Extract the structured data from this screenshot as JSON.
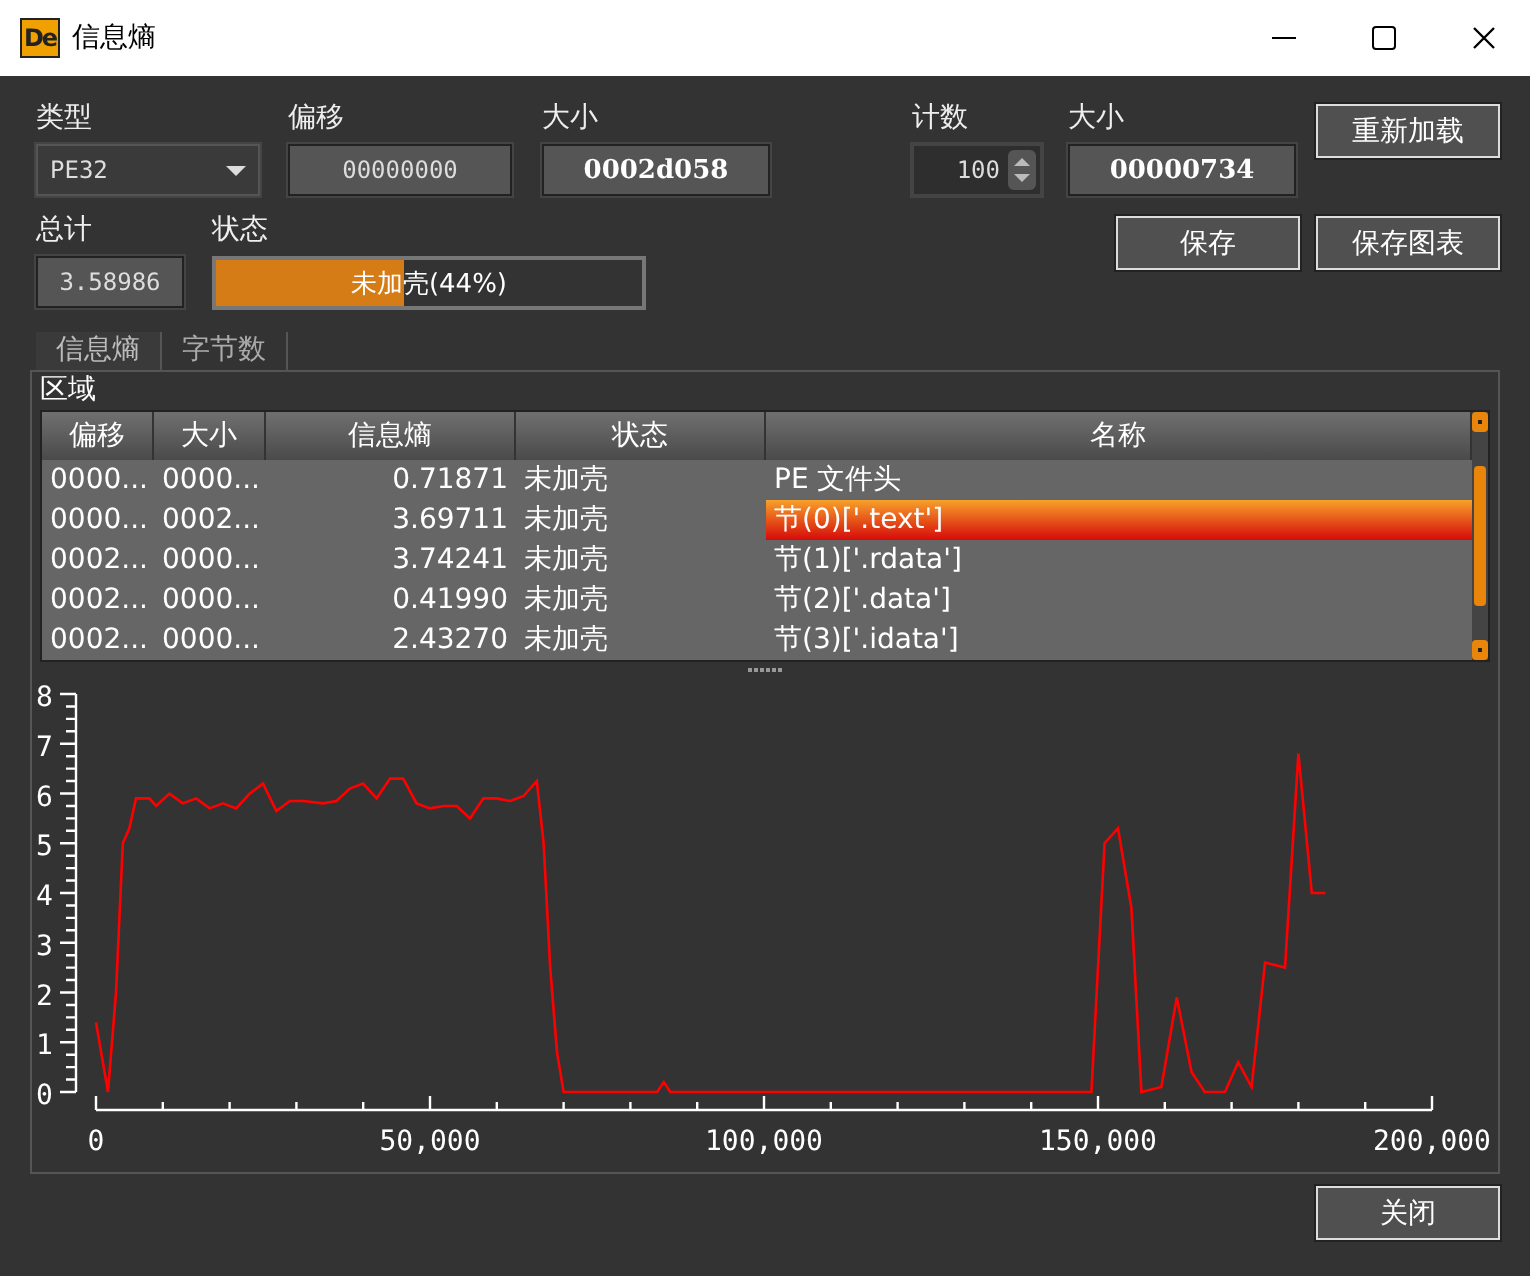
{
  "window": {
    "logo": "De",
    "title": "信息熵"
  },
  "fields_row1": [
    {
      "kind": "combo",
      "label": "类型",
      "value": "PE32"
    },
    {
      "kind": "text",
      "label": "偏移",
      "value": "00000000"
    },
    {
      "kind": "bold",
      "label": "大小",
      "value": "0002d058"
    },
    {
      "kind": "spin",
      "label": "计数",
      "value": "100"
    },
    {
      "kind": "bold",
      "label": "大小",
      "value": "00000734"
    }
  ],
  "reload_button": "重新加载",
  "total": {
    "label": "总计",
    "value": "3.58986"
  },
  "status": {
    "label": "状态",
    "text": "未加壳(44%)",
    "level": 0.44
  },
  "save_button": "保存",
  "save_chart_button": "保存图表",
  "tabs": [
    {
      "label": "信息熵",
      "selected": true
    },
    {
      "label": "字节数",
      "selected": false
    }
  ],
  "group_title": "区域",
  "table": {
    "columns": [
      "偏移",
      "大小",
      "信息熵",
      "状态",
      "名称"
    ],
    "rows": [
      {
        "cells": [
          "0000...",
          "0000...",
          "0.71871",
          "未加壳",
          "PE 文件头"
        ],
        "selected": false
      },
      {
        "cells": [
          "0000...",
          "0002...",
          "3.69711",
          "未加壳",
          "节(0)['.text']"
        ],
        "selected": true
      },
      {
        "cells": [
          "0002...",
          "0000...",
          "3.74241",
          "未加壳",
          "节(1)['.rdata']"
        ],
        "selected": false
      },
      {
        "cells": [
          "0002...",
          "0000...",
          "0.41990",
          "未加壳",
          "节(2)['.data']"
        ],
        "selected": false
      },
      {
        "cells": [
          "0002...",
          "0000...",
          "2.43270",
          "未加壳",
          "节(3)['.idata']"
        ],
        "selected": false
      }
    ]
  },
  "chart": {
    "chart_data": {
      "type": "line",
      "xlim": [
        0,
        200000
      ],
      "ylim": [
        0,
        8
      ],
      "xticks": [
        0,
        {
          "value": 50000,
          "label": "50,000"
        },
        {
          "value": 100000,
          "label": "100,000"
        },
        {
          "value": 150000,
          "label": "150,000"
        },
        {
          "value": 200000,
          "label": "200,000"
        }
      ],
      "yticks": [
        0,
        1,
        2,
        3,
        4,
        5,
        6,
        7,
        8
      ],
      "x": [
        0,
        1800,
        3000,
        4000,
        5000,
        6000,
        8000,
        9000,
        11000,
        13000,
        15000,
        17000,
        19000,
        21000,
        23000,
        25000,
        27000,
        29000,
        31000,
        34000,
        36000,
        38000,
        40000,
        42000,
        44000,
        46000,
        48000,
        50000,
        52000,
        54000,
        56000,
        58000,
        60000,
        62000,
        64000,
        66000,
        67000,
        68000,
        69000,
        70000,
        84000,
        85000,
        86000,
        149000,
        151000,
        153000,
        155000,
        156500,
        159500,
        161800,
        164000,
        166000,
        169000,
        171000,
        173000,
        175000,
        178000,
        180000,
        182000,
        184000
      ],
      "series": [
        {
          "color": "#ff0000",
          "values": [
            1.4,
            0,
            2,
            5.0,
            5.3,
            5.9,
            5.9,
            5.75,
            6.0,
            5.8,
            5.9,
            5.7,
            5.8,
            5.7,
            6.0,
            6.2,
            5.65,
            5.85,
            5.85,
            5.8,
            5.85,
            6.1,
            6.2,
            5.9,
            6.3,
            6.3,
            5.8,
            5.7,
            5.75,
            5.75,
            5.5,
            5.9,
            5.9,
            5.85,
            5.95,
            6.25,
            5.0,
            2.5,
            0.8,
            0,
            0,
            0.2,
            0,
            0,
            5.0,
            5.3,
            3.7,
            0,
            0.1,
            1.9,
            0.4,
            0,
            0,
            0.6,
            0.1,
            2.6,
            2.5,
            6.8,
            4.0,
            4.0
          ]
        }
      ]
    }
  },
  "close_button": "关闭"
}
